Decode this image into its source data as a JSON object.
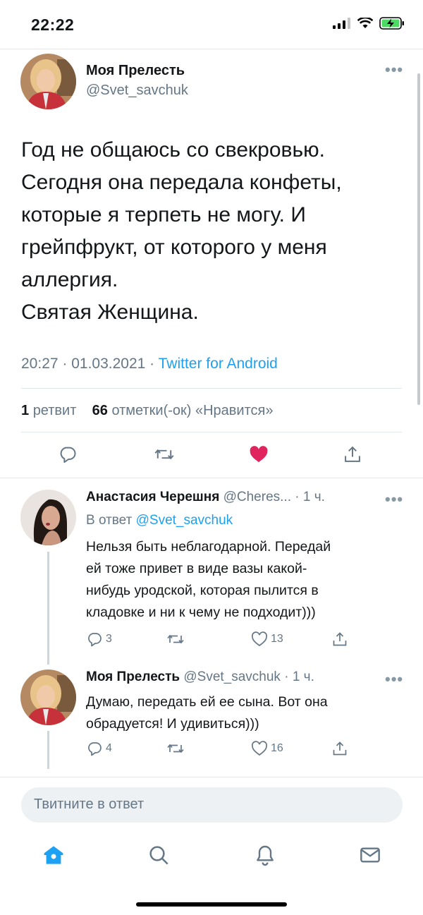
{
  "status_bar": {
    "time": "22:22"
  },
  "main_tweet": {
    "author_name": "Моя Прелесть",
    "author_handle": "@Svet_savchuk",
    "text_lines": [
      "Год не общаюсь со свекровью.",
      "Сегодня она передала конфеты,",
      "которые я терпеть не могу. И",
      "грейпфрукт, от которого у меня",
      "аллергия.",
      "Святая Женщина."
    ],
    "time": "20:27 · 01.03.2021 ·",
    "source": "Twitter for Android",
    "retweets_count": "1",
    "retweets_label": "ретвит",
    "likes_count": "66",
    "likes_label": "отметки(-ок) «Нравится»"
  },
  "replies": [
    {
      "author_name": "Анастасия Черешня",
      "author_handle": "@Cheres...",
      "time": "· 1 ч.",
      "reply_to_label": "В ответ",
      "reply_to_handle": "@Svet_savchuk",
      "text_lines": [
        "Нельзя быть неблагодарной. Передай",
        "ей тоже привет в виде вазы какой-",
        "нибудь уродской, которая пылится в",
        "кладовке и ни к чему не подходит)))"
      ],
      "reply_count": "3",
      "retweet_count": "",
      "like_count": "13"
    },
    {
      "author_name": "Моя Прелесть",
      "author_handle": "@Svet_savchuk",
      "time": "· 1 ч.",
      "text_lines": [
        "Думаю, передать ей ее сына. Вот она",
        "обрадуется! И удивиться)))"
      ],
      "reply_count": "4",
      "retweet_count": "",
      "like_count": "16"
    }
  ],
  "composer": {
    "placeholder": "Твитните в ответ"
  },
  "nav": [
    "home-icon",
    "search-icon",
    "notifications-icon",
    "messages-icon"
  ],
  "colors": {
    "accent": "#1da1f2",
    "like": "#e0245e",
    "muted": "#657786",
    "divider": "#e1e8ed"
  }
}
